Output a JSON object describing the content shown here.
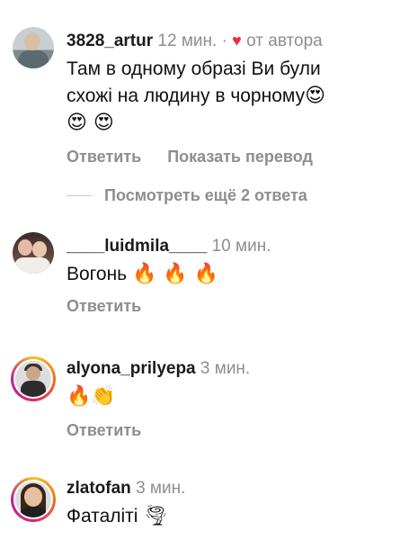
{
  "comments": [
    {
      "username": "3828_artur",
      "time": "12 мин.",
      "separator": "·",
      "heart_icon": "♥",
      "by_author": "от автора",
      "text_line1": "Там в одному образі Ви були",
      "text_line2": "схожі на людину в чорному",
      "emoji_a": "😍",
      "emoji_b": "😍 😍",
      "reply_label": "Ответить",
      "translate_label": "Показать перевод"
    },
    {
      "username": "____luidmila____",
      "time": "10 мин.",
      "text": "Вогонь",
      "emoji": "🔥 🔥 🔥",
      "reply_label": "Ответить"
    },
    {
      "username": "alyona_prilyepa",
      "time": "3 мин.",
      "emoji": "🔥👏",
      "reply_label": "Ответить"
    },
    {
      "username": "zlatofan",
      "time": "3 мин.",
      "text": "Фаталіті",
      "emoji": "🌪"
    }
  ],
  "view_replies_label": "Посмотреть ещё 2 ответа",
  "colors": {
    "muted": "#8e8e8e",
    "heart": "#ed2c4a",
    "text": "#111111"
  },
  "icons": {
    "heart": "heart-icon",
    "fire": "fire-emoji",
    "heart_eyes": "heart-eyes-emoji",
    "clap": "clapping-hands-emoji",
    "tornado": "tornado-emoji"
  }
}
